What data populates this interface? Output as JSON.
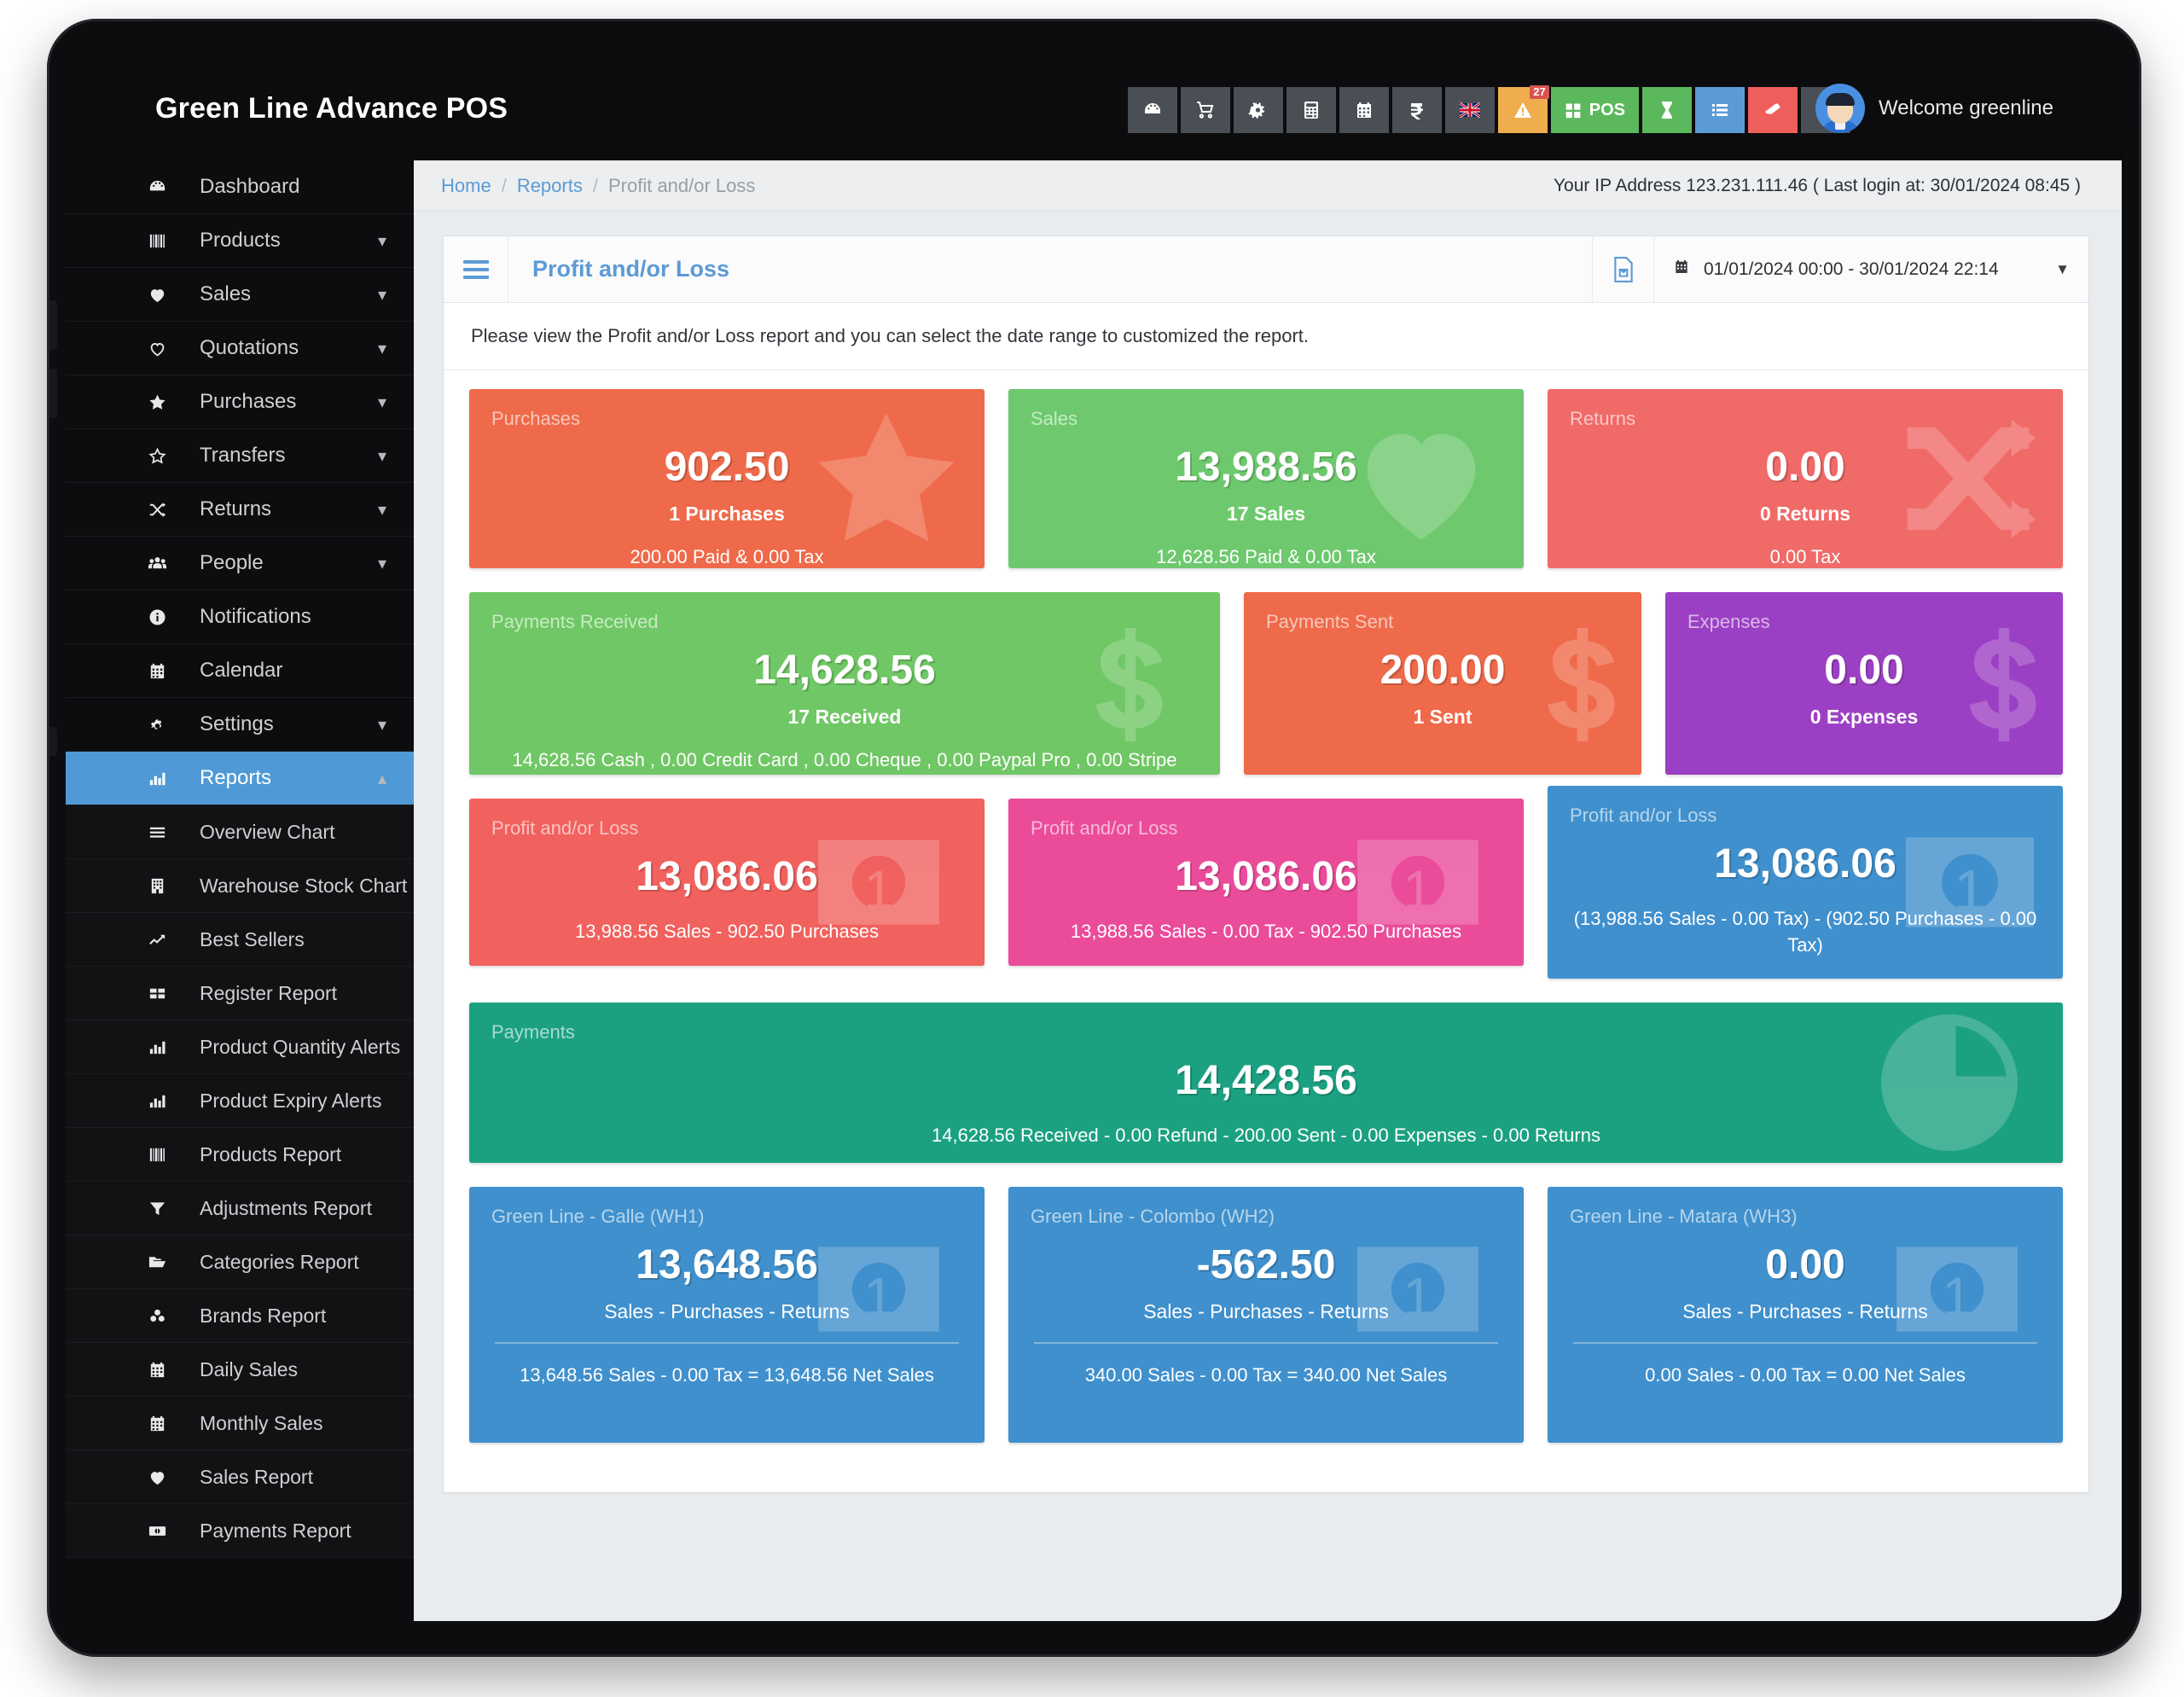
{
  "app": {
    "brand": "Green Line Advance POS",
    "username": "Welcome greenline"
  },
  "topnav": {
    "icons": [
      {
        "name": "dashboard-icon",
        "label": ""
      },
      {
        "name": "cart-icon",
        "label": ""
      },
      {
        "name": "gears-icon",
        "label": ""
      },
      {
        "name": "calculator-icon",
        "label": ""
      },
      {
        "name": "calendar-icon",
        "label": ""
      },
      {
        "name": "currency-icon",
        "label": ""
      },
      {
        "name": "flag-icon",
        "label": ""
      }
    ],
    "alert_badge": "27",
    "pos_label": "POS"
  },
  "breadcrumb": {
    "home": "Home",
    "reports": "Reports",
    "current": "Profit and/or Loss",
    "separator": "/"
  },
  "ip_info": "Your IP Address 123.231.111.46 ( Last login at: 30/01/2024 08:45 )",
  "panel": {
    "title": "Profit and/or Loss",
    "date_range": "01/01/2024 00:00 - 30/01/2024 22:14",
    "intro": "Please view the Profit and/or Loss report and you can select the date range to customized the report."
  },
  "sidebar": {
    "items": [
      {
        "label": "Dashboard",
        "icon": "dashboard-icon",
        "caret": false,
        "active": false,
        "sub": false
      },
      {
        "label": "Products",
        "icon": "barcode-icon",
        "caret": true,
        "active": false,
        "sub": false
      },
      {
        "label": "Sales",
        "icon": "heart-filled-icon",
        "caret": true,
        "active": false,
        "sub": false
      },
      {
        "label": "Quotations",
        "icon": "heart-outline-icon",
        "caret": true,
        "active": false,
        "sub": false
      },
      {
        "label": "Purchases",
        "icon": "star-filled-icon",
        "caret": true,
        "active": false,
        "sub": false
      },
      {
        "label": "Transfers",
        "icon": "star-outline-icon",
        "caret": true,
        "active": false,
        "sub": false
      },
      {
        "label": "Returns",
        "icon": "shuffle-icon",
        "caret": true,
        "active": false,
        "sub": false
      },
      {
        "label": "People",
        "icon": "users-icon",
        "caret": true,
        "active": false,
        "sub": false
      },
      {
        "label": "Notifications",
        "icon": "info-icon",
        "caret": false,
        "active": false,
        "sub": false
      },
      {
        "label": "Calendar",
        "icon": "calendar-icon",
        "caret": false,
        "active": false,
        "sub": false
      },
      {
        "label": "Settings",
        "icon": "gear-icon",
        "caret": true,
        "active": false,
        "sub": false
      },
      {
        "label": "Reports",
        "icon": "bar-chart-icon",
        "caret": true,
        "active": true,
        "sub": false
      },
      {
        "label": "Overview Chart",
        "icon": "list-icon",
        "caret": false,
        "active": false,
        "sub": true
      },
      {
        "label": "Warehouse Stock Chart",
        "icon": "building-icon",
        "caret": false,
        "active": false,
        "sub": true
      },
      {
        "label": "Best Sellers",
        "icon": "line-chart-icon",
        "caret": false,
        "active": false,
        "sub": true
      },
      {
        "label": "Register Report",
        "icon": "grid-icon",
        "caret": false,
        "active": false,
        "sub": true
      },
      {
        "label": "Product Quantity Alerts",
        "icon": "bar-chart-icon",
        "caret": false,
        "active": false,
        "sub": true
      },
      {
        "label": "Product Expiry Alerts",
        "icon": "bar-chart-icon",
        "caret": false,
        "active": false,
        "sub": true
      },
      {
        "label": "Products Report",
        "icon": "barcode-icon",
        "caret": false,
        "active": false,
        "sub": true
      },
      {
        "label": "Adjustments Report",
        "icon": "filter-icon",
        "caret": false,
        "active": false,
        "sub": true
      },
      {
        "label": "Categories Report",
        "icon": "folder-icon",
        "caret": false,
        "active": false,
        "sub": true
      },
      {
        "label": "Brands Report",
        "icon": "cubes-icon",
        "caret": false,
        "active": false,
        "sub": true
      },
      {
        "label": "Daily Sales",
        "icon": "calendar-icon",
        "caret": false,
        "active": false,
        "sub": true
      },
      {
        "label": "Monthly Sales",
        "icon": "calendar-icon",
        "caret": false,
        "active": false,
        "sub": true
      },
      {
        "label": "Sales Report",
        "icon": "heart-filled-icon",
        "caret": false,
        "active": false,
        "sub": true
      },
      {
        "label": "Payments Report",
        "icon": "money-icon",
        "caret": false,
        "active": false,
        "sub": true
      }
    ]
  },
  "chart_data": {
    "type": "table",
    "title": "Profit and/or Loss",
    "cards": [
      {
        "title": "Purchases",
        "value": "902.50",
        "sub": "1 Purchases",
        "foot": "200.00 Paid & 0.00 Tax",
        "color": "#ef6a4a",
        "bg_icon": "star-icon"
      },
      {
        "title": "Sales",
        "value": "13,988.56",
        "sub": "17 Sales",
        "foot": "12,628.56 Paid & 0.00 Tax",
        "color": "#6ec96e",
        "bg_icon": "heart-icon"
      },
      {
        "title": "Returns",
        "value": "0.00",
        "sub": "0 Returns",
        "foot": "0.00 Tax",
        "color": "#f06a68",
        "bg_icon": "shuffle-icon"
      },
      {
        "title": "Payments Received",
        "value": "14,628.56",
        "sub": "17 Received",
        "foot": "14,628.56 Cash , 0.00 Credit Card , 0.00 Cheque , 0.00 Paypal Pro , 0.00 Stripe",
        "color": "#70c765",
        "bg_icon": "dollar-icon"
      },
      {
        "title": "Payments Sent",
        "value": "200.00",
        "sub": "1 Sent",
        "foot": "",
        "color": "#ef6a4a",
        "bg_icon": "dollar-icon"
      },
      {
        "title": "Expenses",
        "value": "0.00",
        "sub": "0 Expenses",
        "foot": "",
        "color": "#9b40c4",
        "bg_icon": "dollar-icon"
      },
      {
        "title": "Profit and/or Loss",
        "value": "13,086.06",
        "sub": "",
        "foot": "13,988.56 Sales - 902.50 Purchases",
        "color": "#f1615e",
        "bg_icon": "money-bill-icon"
      },
      {
        "title": "Profit and/or Loss",
        "value": "13,086.06",
        "sub": "",
        "foot": "13,988.56 Sales - 0.00 Tax - 902.50 Purchases",
        "color": "#ea4c9a",
        "bg_icon": "money-bill-icon"
      },
      {
        "title": "Profit and/or Loss",
        "value": "13,086.06",
        "sub": "",
        "foot": "(13,988.56 Sales - 0.00 Tax) - (902.50 Purchases - 0.00 Tax)",
        "color": "#4090cd",
        "bg_icon": "money-bill-icon"
      },
      {
        "title": "Payments",
        "value": "14,428.56",
        "sub": "",
        "foot": "14,628.56 Received - 0.00 Refund - 200.00 Sent - 0.00 Expenses - 0.00 Returns",
        "color": "#1ba181",
        "bg_icon": "pie-chart-icon"
      },
      {
        "title": "Green Line - Galle (WH1)",
        "value": "13,648.56",
        "sub": "Sales - Purchases - Returns",
        "foot": "13,648.56 Sales - 0.00 Tax = 13,648.56 Net Sales",
        "color": "#4090cd",
        "bg_icon": "money-bill-icon"
      },
      {
        "title": "Green Line - Colombo (WH2)",
        "value": "-562.50",
        "sub": "Sales - Purchases - Returns",
        "foot": "340.00 Sales - 0.00 Tax = 340.00 Net Sales",
        "color": "#4090cd",
        "bg_icon": "money-bill-icon"
      },
      {
        "title": "Green Line - Matara (WH3)",
        "value": "0.00",
        "sub": "Sales - Purchases - Returns",
        "foot": "0.00 Sales - 0.00 Tax = 0.00 Net Sales",
        "color": "#4090cd",
        "bg_icon": "money-bill-icon"
      }
    ]
  },
  "cards": {
    "purchases": {
      "title": "Purchases",
      "value": "902.50",
      "sub": "1 Purchases",
      "foot": "200.00 Paid & 0.00 Tax"
    },
    "sales": {
      "title": "Sales",
      "value": "13,988.56",
      "sub": "17 Sales",
      "foot": "12,628.56 Paid & 0.00 Tax"
    },
    "returns": {
      "title": "Returns",
      "value": "0.00",
      "sub": "0 Returns",
      "foot": "0.00 Tax"
    },
    "payrecv": {
      "title": "Payments Received",
      "value": "14,628.56",
      "sub": "17 Received",
      "foot": "14,628.56 Cash , 0.00 Credit Card , 0.00 Cheque , 0.00 Paypal Pro , 0.00 Stripe"
    },
    "paysent": {
      "title": "Payments Sent",
      "value": "200.00",
      "sub": "1 Sent"
    },
    "expenses": {
      "title": "Expenses",
      "value": "0.00",
      "sub": "0 Expenses"
    },
    "pl1": {
      "title": "Profit and/or Loss",
      "value": "13,086.06",
      "foot": "13,988.56 Sales - 902.50 Purchases"
    },
    "pl2": {
      "title": "Profit and/or Loss",
      "value": "13,086.06",
      "foot": "13,988.56 Sales - 0.00 Tax - 902.50 Purchases"
    },
    "pl3": {
      "title": "Profit and/or Loss",
      "value": "13,086.06",
      "foot": "(13,988.56 Sales - 0.00 Tax) - (902.50 Purchases - 0.00 Tax)"
    },
    "payments": {
      "title": "Payments",
      "value": "14,428.56",
      "foot": "14,628.56 Received - 0.00 Refund - 200.00 Sent - 0.00 Expenses - 0.00 Returns"
    },
    "wh1": {
      "title": "Green Line - Galle (WH1)",
      "value": "13,648.56",
      "sub": "Sales - Purchases - Returns",
      "net": "13,648.56 Sales - 0.00 Tax = 13,648.56 Net Sales"
    },
    "wh2": {
      "title": "Green Line - Colombo (WH2)",
      "value": "-562.50",
      "sub": "Sales - Purchases - Returns",
      "net": "340.00 Sales - 0.00 Tax = 340.00 Net Sales"
    },
    "wh3": {
      "title": "Green Line - Matara (WH3)",
      "value": "0.00",
      "sub": "Sales - Purchases - Returns",
      "net": "0.00 Sales - 0.00 Tax = 0.00 Net Sales"
    }
  }
}
